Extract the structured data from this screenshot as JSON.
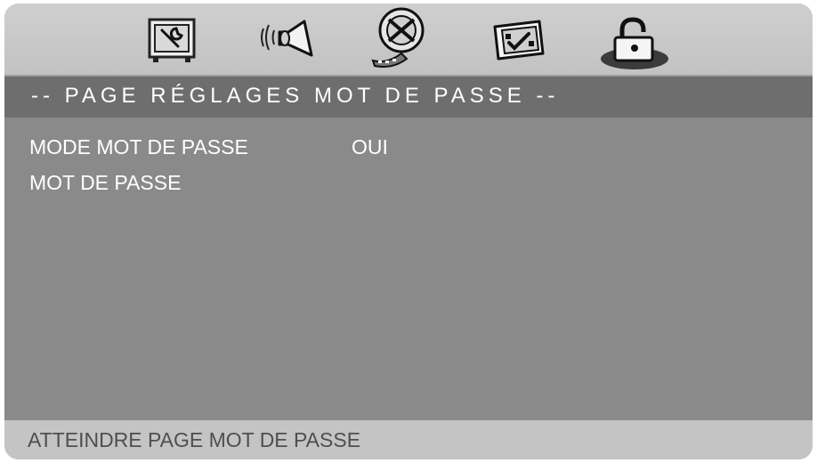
{
  "menu": {
    "icons": [
      {
        "name": "settings-wrench-icon",
        "active": false
      },
      {
        "name": "audio-speaker-icon",
        "active": false
      },
      {
        "name": "video-film-reel-icon",
        "active": false
      },
      {
        "name": "preferences-checklist-icon",
        "active": false
      },
      {
        "name": "password-lock-icon",
        "active": true
      }
    ]
  },
  "page": {
    "title": "-- PAGE RÉGLAGES MOT DE PASSE --"
  },
  "settings": [
    {
      "label": "MODE MOT DE PASSE",
      "value": "OUI"
    },
    {
      "label": "MOT DE PASSE",
      "value": ""
    }
  ],
  "status": {
    "text": "ATTEINDRE PAGE MOT DE PASSE"
  },
  "colors": {
    "background": "#8a8a8a",
    "title_bar": "#6e6e6e",
    "icon_bar": "#c8c8c8",
    "status_bar": "#c4c4c4",
    "text": "#ffffff",
    "status_text": "#4f4f4f"
  }
}
